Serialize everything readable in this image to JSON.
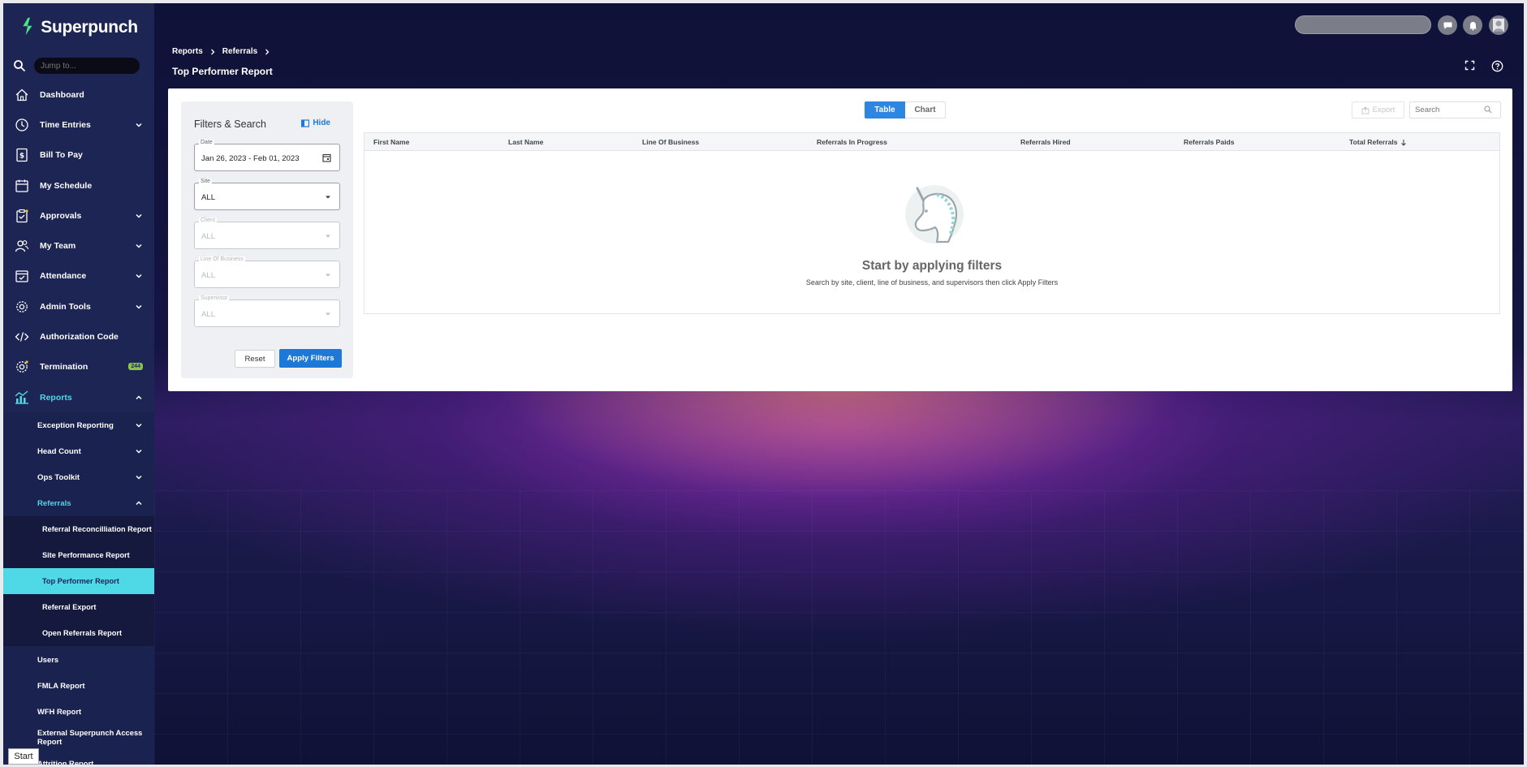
{
  "app": {
    "brand": "Superpunch"
  },
  "sidebar": {
    "jump_placeholder": "Jump to...",
    "items": [
      {
        "label": "Dashboard"
      },
      {
        "label": "Time Entries"
      },
      {
        "label": "Bill To Pay"
      },
      {
        "label": "My Schedule"
      },
      {
        "label": "Approvals"
      },
      {
        "label": "My Team"
      },
      {
        "label": "Attendance"
      },
      {
        "label": "Admin Tools"
      },
      {
        "label": "Authorization Code"
      },
      {
        "label": "Termination",
        "badge": "244"
      },
      {
        "label": "Reports"
      }
    ],
    "report_groups": [
      {
        "label": "Exception Reporting"
      },
      {
        "label": "Head Count"
      },
      {
        "label": "Ops Toolkit"
      },
      {
        "label": "Referrals"
      }
    ],
    "referral_reports": [
      {
        "label": "Referral Reconcilliation Report"
      },
      {
        "label": "Site Performance Report"
      },
      {
        "label": "Top Performer Report"
      },
      {
        "label": "Referral Export"
      },
      {
        "label": "Open Referrals Report"
      }
    ],
    "other_reports": [
      {
        "label": "Users"
      },
      {
        "label": "FMLA Report"
      },
      {
        "label": "WFH Report"
      },
      {
        "label": "External Superpunch Access Report"
      },
      {
        "label": "Attrition Report"
      }
    ],
    "start_label": "Start"
  },
  "breadcrumb": {
    "first": "Reports",
    "second": "Referrals"
  },
  "page": {
    "title": "Top Performer Report"
  },
  "filters": {
    "title": "Filters & Search",
    "hide_label": "Hide",
    "date": {
      "label": "Date",
      "value": "Jan 26, 2023 - Feb 01, 2023"
    },
    "site": {
      "label": "Site",
      "value": "ALL"
    },
    "client": {
      "label": "Client",
      "value": "ALL"
    },
    "line_of_business": {
      "label": "Line Of Business",
      "value": "ALL"
    },
    "supervisor": {
      "label": "Supervisor",
      "value": "ALL"
    },
    "reset_label": "Reset",
    "apply_label": "Apply Filters"
  },
  "view_toggle": {
    "table": "Table",
    "chart": "Chart"
  },
  "toolbar": {
    "export_label": "Export",
    "search_placeholder": "Search"
  },
  "table": {
    "columns": [
      "First Name",
      "Last Name",
      "Line Of Business",
      "Referrals In Progress",
      "Referrals Hired",
      "Referrals Paids",
      "Total Referrals"
    ],
    "sort_column": "Total Referrals",
    "sort_direction": "descending"
  },
  "empty_state": {
    "title": "Start by applying filters",
    "subtitle": "Search by site, client, line of business, and supervisors then click Apply Filters"
  },
  "colors": {
    "sidebar_bg": "#1c2554",
    "accent_cyan": "#4fd8e6",
    "primary_blue": "#1e78d6",
    "badge_green": "#8bc34a"
  }
}
